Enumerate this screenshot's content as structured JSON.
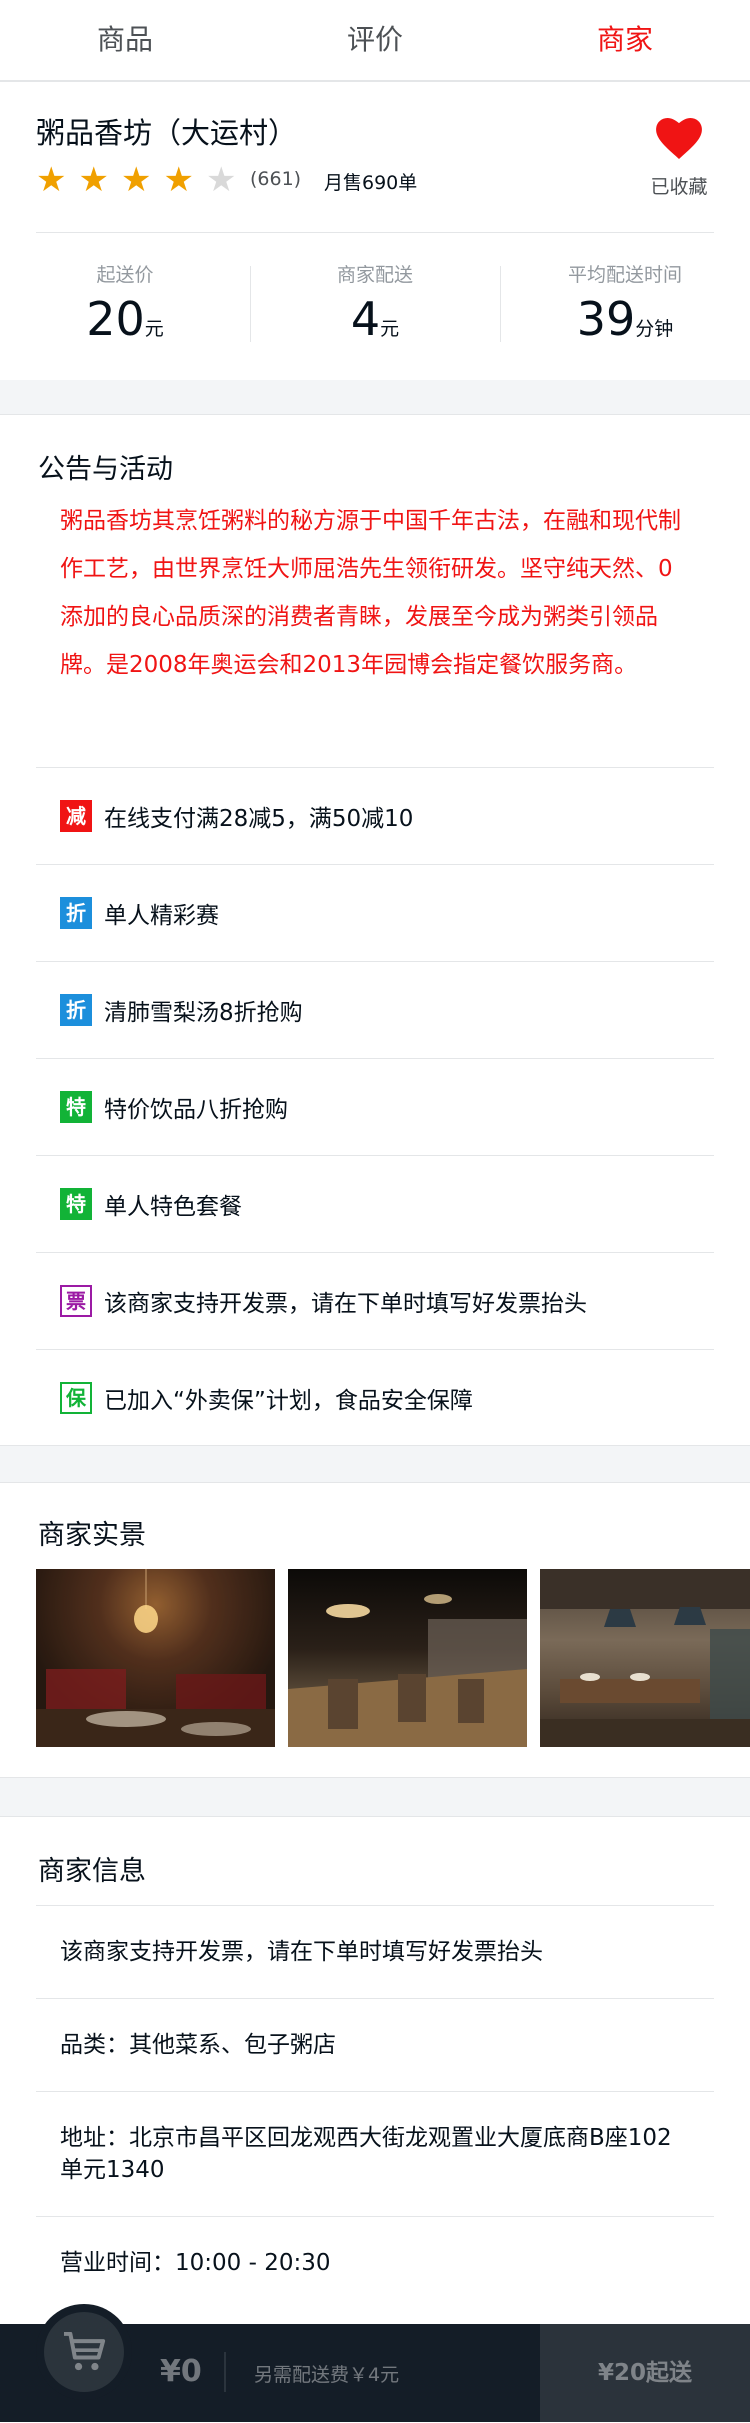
{
  "tabs": [
    {
      "label": "商品"
    },
    {
      "label": "评价"
    },
    {
      "label": "商家",
      "active": true
    }
  ],
  "seller": {
    "name": "粥品香坊（大运村）",
    "score": 4,
    "rating_count": "(661)",
    "sell_count": "月售690单",
    "favorite_label": "已收藏",
    "stats": [
      {
        "title": "起送价",
        "value": "20",
        "unit": "元"
      },
      {
        "title": "商家配送",
        "value": "4",
        "unit": "元"
      },
      {
        "title": "平均配送时间",
        "value": "39",
        "unit": "分钟"
      }
    ]
  },
  "bulletin": {
    "title": "公告与活动",
    "text": "粥品香坊其烹饪粥料的秘方源于中国千年古法，在融和现代制作工艺，由世界烹饪大师屈浩先生领衔研发。坚守纯天然、0添加的良心品质深的消费者青睐，发展至今成为粥类引领品牌。是2008年奥运会和2013年园博会指定餐饮服务商。",
    "supports": [
      {
        "icon": "减",
        "type": "decrease",
        "color": "#f01414",
        "text": "在线支付满28减5，满50减10"
      },
      {
        "icon": "折",
        "type": "discount",
        "color": "#1c8fdc",
        "text": "单人精彩赛"
      },
      {
        "icon": "折",
        "type": "discount",
        "color": "#1c8fdc",
        "text": "清肺雪梨汤8折抢购"
      },
      {
        "icon": "特",
        "type": "special",
        "color": "#12b337",
        "text": "特价饮品八折抢购"
      },
      {
        "icon": "特",
        "type": "special",
        "color": "#12b337",
        "text": "单人特色套餐"
      },
      {
        "icon": "票",
        "type": "invoice",
        "color": "#9b1aa4",
        "text": "该商家支持开发票，请在下单时填写好发票抬头"
      },
      {
        "icon": "保",
        "type": "guarantee",
        "color": "#12b337",
        "text": "已加入“外卖保”计划，食品安全保障"
      }
    ]
  },
  "pics": {
    "title": "商家实景",
    "items": [
      {
        "name": "restaurant-photo-1"
      },
      {
        "name": "restaurant-photo-2"
      },
      {
        "name": "restaurant-photo-3"
      }
    ]
  },
  "info": {
    "title": "商家信息",
    "items": [
      "该商家支持开发票，请在下单时填写好发票抬头",
      "品类：其他菜系、包子粥店",
      "地址：北京市昌平区回龙观西大街龙观置业大厦底商B座102单元1340",
      "营业时间：10:00 - 20:30"
    ]
  },
  "cart": {
    "icon": "shopping-cart-icon",
    "total_price": "¥0",
    "delivery_fee_text": "另需配送费￥4元",
    "pay_label": "¥20起送"
  },
  "colors": {
    "accent_red": "#f01414",
    "cart_bg": "#141d27"
  }
}
